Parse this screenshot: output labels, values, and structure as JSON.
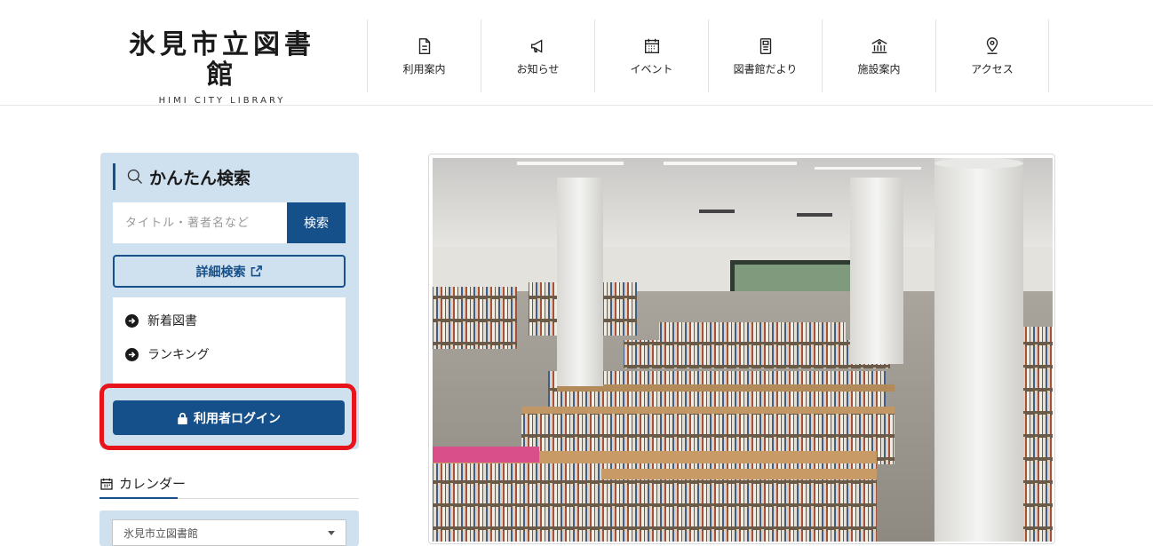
{
  "header": {
    "logo_ja": "氷見市立図書館",
    "logo_en": "HIMI CITY LIBRARY",
    "nav": [
      {
        "label": "利用案内",
        "icon": "document-icon"
      },
      {
        "label": "お知らせ",
        "icon": "megaphone-icon"
      },
      {
        "label": "イベント",
        "icon": "calendar-icon"
      },
      {
        "label": "図書館だより",
        "icon": "newsletter-icon"
      },
      {
        "label": "施設案内",
        "icon": "building-icon"
      },
      {
        "label": "アクセス",
        "icon": "map-pin-icon"
      }
    ]
  },
  "search": {
    "title": "かんたん検索",
    "placeholder": "タイトル・著者名など",
    "submit_label": "検索",
    "detail_label": "詳細検索",
    "links": [
      {
        "label": "新着図書"
      },
      {
        "label": "ランキング"
      }
    ],
    "login_label": "利用者ログイン"
  },
  "calendar": {
    "title": "カレンダー",
    "selected_library": "氷見市立図書館"
  },
  "colors": {
    "accent": "#16508b",
    "panel_bg": "#cfe0ef",
    "highlight": "#e8141b"
  }
}
